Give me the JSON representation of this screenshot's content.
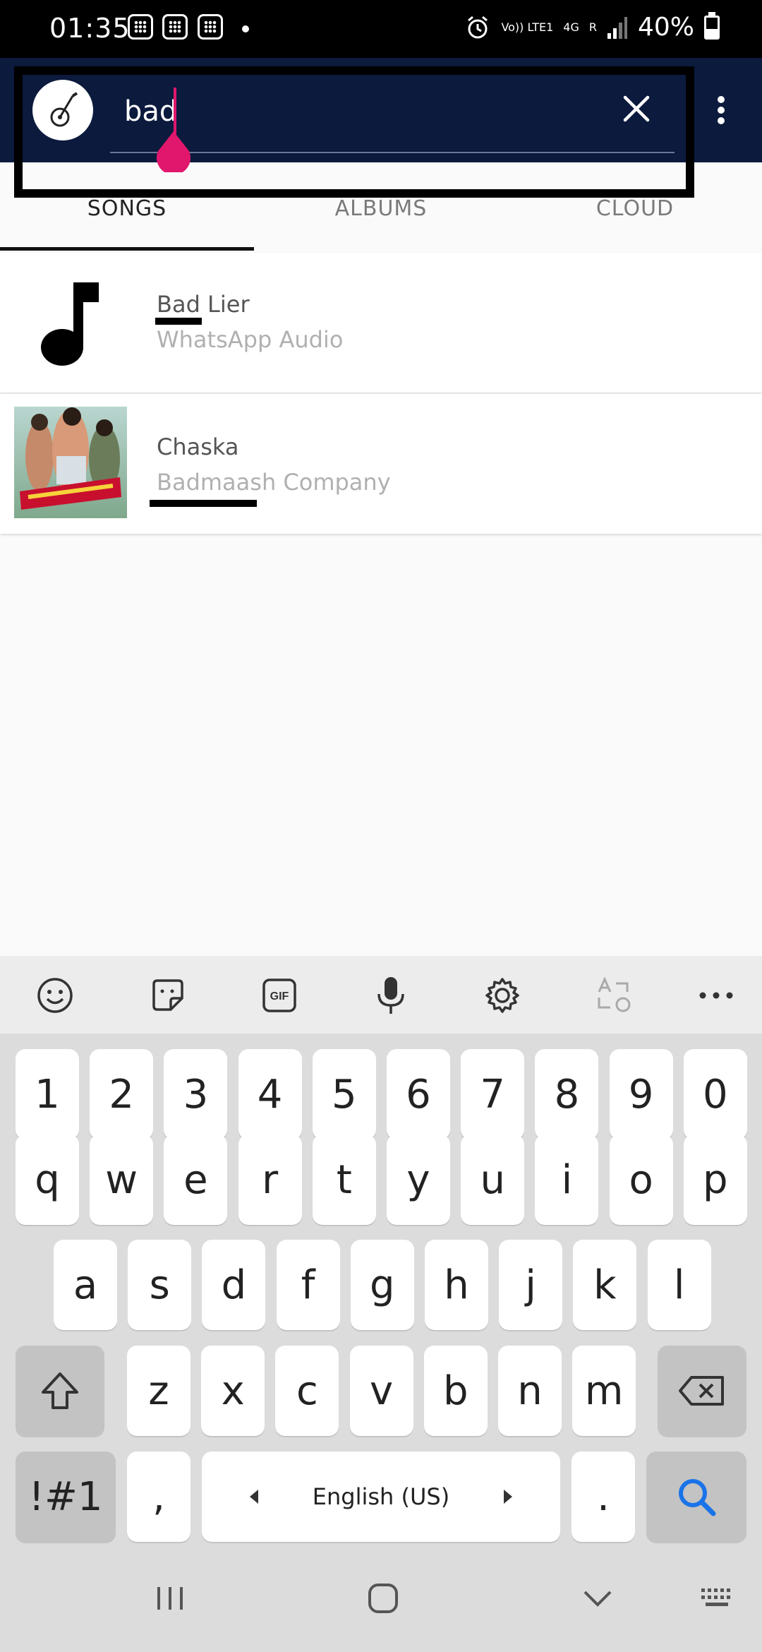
{
  "status_bar": {
    "time": "01:35",
    "network_top": "Vo)) LTE1",
    "network_type": "4G",
    "roaming": "R",
    "battery": "40%"
  },
  "search": {
    "query": "bad",
    "placeholder": ""
  },
  "tabs": [
    {
      "label": "SONGS",
      "active": true
    },
    {
      "label": "ALBUMS",
      "active": false
    },
    {
      "label": "CLOUD",
      "active": false
    }
  ],
  "results": [
    {
      "title": "Bad Lier",
      "subtitle": "WhatsApp Audio",
      "thumb": "music-note-icon"
    },
    {
      "title": "Chaska",
      "subtitle": "Badmaash Company",
      "thumb": "album-art"
    }
  ],
  "keyboard": {
    "toolbar": [
      "emoji-icon",
      "sticker-icon",
      "gif-icon",
      "mic-icon",
      "settings-icon",
      "translate-icon",
      "more-icon"
    ],
    "gif_label": "GIF",
    "row_numbers": [
      "1",
      "2",
      "3",
      "4",
      "5",
      "6",
      "7",
      "8",
      "9",
      "0"
    ],
    "row_top": [
      "q",
      "w",
      "e",
      "r",
      "t",
      "y",
      "u",
      "i",
      "o",
      "p"
    ],
    "row_mid": [
      "a",
      "s",
      "d",
      "f",
      "g",
      "h",
      "j",
      "k",
      "l"
    ],
    "row_bottom": [
      "z",
      "x",
      "c",
      "v",
      "b",
      "n",
      "m"
    ],
    "symbols_label": "!#1",
    "comma_label": ",",
    "space_label": "English (US)",
    "period_label": "."
  },
  "colors": {
    "app_bar": "#0b1a3d",
    "caret": "#e0176d",
    "search_key_icon": "#1a73e8"
  }
}
